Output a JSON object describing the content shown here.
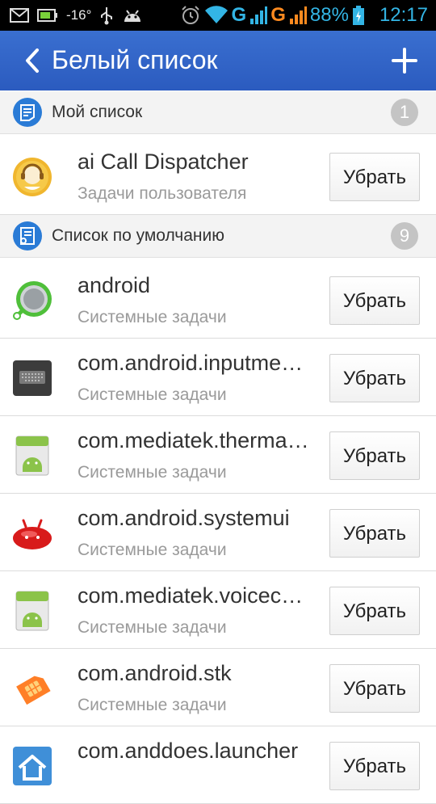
{
  "status_bar": {
    "temperature": "-16°",
    "battery_percent": "88%",
    "time": "12:17",
    "network1": "G",
    "network2": "G",
    "icons": [
      "gmail-icon",
      "battery-charge-icon",
      "usb-icon",
      "android-debug-icon",
      "alarm-icon",
      "wifi-icon",
      "signal-icon",
      "battery-icon"
    ]
  },
  "header": {
    "title": "Белый список",
    "back_icon": "chevron-left-icon",
    "add_icon": "plus-icon"
  },
  "sections": {
    "my_list": {
      "label": "Мой список",
      "count": "1",
      "icon": "list-icon"
    },
    "default_list": {
      "label": "Список по умолчанию",
      "count": "9",
      "icon": "list-settings-icon"
    }
  },
  "my_list_items": [
    {
      "name": "ai Call Dispatcher",
      "subtitle": "Задачи пользователя",
      "button": "Убрать",
      "icon": "call-dispatcher-app-icon"
    }
  ],
  "default_list_items": [
    {
      "name": "android",
      "subtitle": "Системные задачи",
      "button": "Убрать",
      "icon": "android-ring-app-icon"
    },
    {
      "name": "com.android.inputme…",
      "subtitle": "Системные задачи",
      "button": "Убрать",
      "icon": "keyboard-app-icon"
    },
    {
      "name": "com.mediatek.therma…",
      "subtitle": "Системные задачи",
      "button": "Убрать",
      "icon": "android-default-app-icon"
    },
    {
      "name": "com.android.systemui",
      "subtitle": "Системные задачи",
      "button": "Убрать",
      "icon": "jellybean-app-icon"
    },
    {
      "name": "com.mediatek.voicec…",
      "subtitle": "Системные задачи",
      "button": "Убрать",
      "icon": "android-default-app-icon"
    },
    {
      "name": "com.android.stk",
      "subtitle": "Системные задачи",
      "button": "Убрать",
      "icon": "sim-card-app-icon"
    },
    {
      "name": "com.anddoes.launcher",
      "subtitle": "",
      "button": "Убрать",
      "icon": "home-launcher-app-icon"
    }
  ],
  "colors": {
    "header": "#2f62c6",
    "accent_blue": "#33b5e5",
    "section_icon": "#2a7bd6"
  }
}
